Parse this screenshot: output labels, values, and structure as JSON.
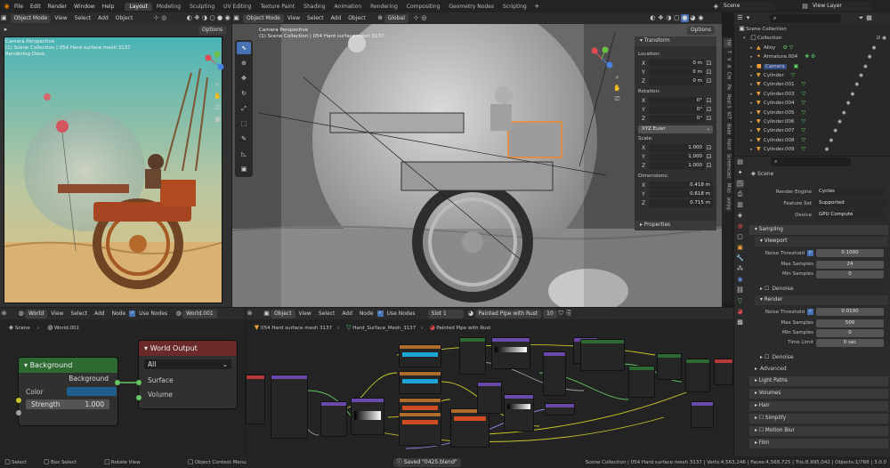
{
  "app": {
    "menus": [
      "File",
      "Edit",
      "Render",
      "Window",
      "Help"
    ],
    "workspaces": [
      "Layout",
      "Modeling",
      "Sculpting",
      "UV Editing",
      "Texture Paint",
      "Shading",
      "Animation",
      "Rendering",
      "Compositing",
      "Geometry Nodes",
      "Scripting"
    ],
    "active_workspace": "Layout",
    "scene_name": "Scene",
    "view_layer": "View Layer"
  },
  "viewport_left": {
    "mode": "Object Mode",
    "menus": [
      "View",
      "Select",
      "Add",
      "Object"
    ],
    "options": "Options",
    "overlay_line1": "Camera Perspective",
    "overlay_line2": "(1) Scene Collection | 054 Hard surface mesh 3137",
    "overlay_line3": "Rendering Done"
  },
  "viewport_main": {
    "mode": "Object Mode",
    "menus": [
      "View",
      "Select",
      "Add",
      "Object"
    ],
    "transform_orientation": "Global",
    "options": "Options",
    "overlay_line1": "Camera Perspective",
    "overlay_line2": "(1) Scene Collection | 054 Hard surface mesh 3137"
  },
  "transform_panel": {
    "title": "Transform",
    "location_label": "Location:",
    "location": [
      {
        "axis": "X",
        "value": "0 m"
      },
      {
        "axis": "Y",
        "value": "0 m"
      },
      {
        "axis": "Z",
        "value": "0 m"
      }
    ],
    "rotation_label": "Rotation:",
    "rotation": [
      {
        "axis": "X",
        "value": "0°"
      },
      {
        "axis": "Y",
        "value": "0°"
      },
      {
        "axis": "Z",
        "value": "0°"
      }
    ],
    "rotation_mode": "XYZ Euler",
    "scale_label": "Scale:",
    "scale": [
      {
        "axis": "X",
        "value": "1.000"
      },
      {
        "axis": "Y",
        "value": "1.000"
      },
      {
        "axis": "Z",
        "value": "1.000"
      }
    ],
    "dimensions_label": "Dimensions:",
    "dimensions": [
      {
        "axis": "X",
        "value": "0.418 m"
      },
      {
        "axis": "Y",
        "value": "0.618 m"
      },
      {
        "axis": "Z",
        "value": "0.715 m"
      }
    ],
    "properties_label": "Properties"
  },
  "sidebar_tabs": [
    "Ite",
    "T",
    "V",
    "A",
    "Cre",
    "Pa",
    "Real S",
    "KIT",
    "Bake",
    "Hard",
    "Screencast",
    "Miss",
    "polyg"
  ],
  "outliner": {
    "search_placeholder": "",
    "root": "Scene Collection",
    "collection": "Collection",
    "items": [
      "Alloy",
      "Armature.004",
      "Camera",
      "Cylinder",
      "Cylinder.001",
      "Cylinder.003",
      "Cylinder.004",
      "Cylinder.005",
      "Cylinder.006",
      "Cylinder.007",
      "Cylinder.008",
      "Cylinder.009"
    ]
  },
  "properties": {
    "scene_label": "Scene",
    "render_engine_label": "Render Engine",
    "render_engine": "Cycles",
    "feature_set_label": "Feature Set",
    "feature_set": "Supported",
    "device_label": "Device",
    "device": "GPU Compute",
    "sampling": "Sampling",
    "viewport": "Viewport",
    "noise_threshold_label": "Noise Threshold",
    "viewport_noise": "0.1000",
    "max_samples_label": "Max Samples",
    "viewport_max_samples": "24",
    "min_samples_label": "Min Samples",
    "viewport_min_samples": "0",
    "denoise": "Denoise",
    "render": "Render",
    "render_noise": "0.0100",
    "render_max_samples": "500",
    "render_min_samples": "0",
    "time_limit_label": "Time Limit",
    "time_limit": "0 sec",
    "advanced": "Advanced",
    "sections": [
      "Light Paths",
      "Volumes",
      "Hair",
      "Simplify",
      "Motion Blur",
      "Film"
    ]
  },
  "world_editor": {
    "type": "World",
    "menus": [
      "View",
      "Select",
      "Add",
      "Node"
    ],
    "use_nodes": "Use Nodes",
    "world_name": "World.001",
    "breadcrumb_scene": "Scene",
    "breadcrumb_world": "World.001",
    "bg_node_title": "Background",
    "bg_output": "Background",
    "color_label": "Color",
    "strength_label": "Strength",
    "strength_value": "1.000",
    "out_node_title": "World Output",
    "out_target": "All",
    "surface": "Surface",
    "volume": "Volume"
  },
  "shader_editor": {
    "type": "Object",
    "menus": [
      "View",
      "Select",
      "Add",
      "Node"
    ],
    "use_nodes": "Use Nodes",
    "slot": "Slot 1",
    "material": "Painted Pipe with Rust",
    "users": "10",
    "breadcrumb_1": "054 Hard surface mesh 3137",
    "breadcrumb_2": "Hard_Surface_Mesh_3137",
    "breadcrumb_3": "Painted Pipe with Rust"
  },
  "statusbar": {
    "select": "Select",
    "box_select": "Box Select",
    "rotate_view": "Rotate View",
    "context_menu": "Object Context Menu",
    "saved": "Saved \"0425.blend\"",
    "stats": "Scene Collection | 054 Hard surface mesh 3137 | Verts:4,563,246 | Faces:4,568,725 | Tris:8,995,042 | Objects:1/788 | 3.0.0"
  },
  "colors": {
    "accent": "#4772b3",
    "active_tab": "#3d3d3d",
    "node_green": "#2d6a31",
    "node_red": "#6b2a2a",
    "socket_yellow": "#c7c729",
    "socket_green": "#63c763",
    "color_swatch": "#1e5d8c"
  }
}
